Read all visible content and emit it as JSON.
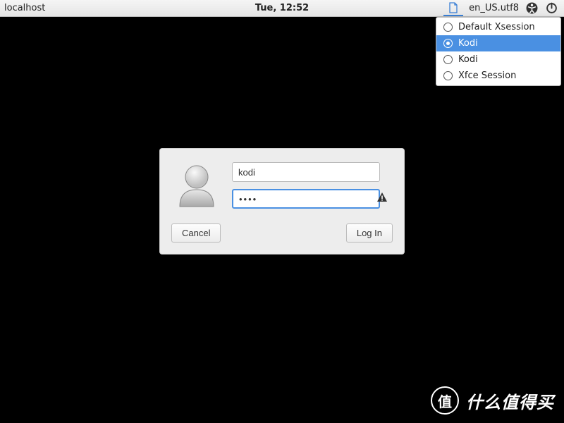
{
  "panel": {
    "hostname": "localhost",
    "clock": "Tue, 12:52",
    "locale": "en_US.utf8"
  },
  "session_menu": {
    "items": [
      {
        "label": "Default Xsession",
        "selected": false
      },
      {
        "label": "Kodi",
        "selected": true
      },
      {
        "label": "Kodi",
        "selected": false
      },
      {
        "label": "Xfce Session",
        "selected": false
      }
    ]
  },
  "login": {
    "username": "kodi",
    "password_mask": "••••",
    "cancel_label": "Cancel",
    "login_label": "Log In"
  },
  "watermark": {
    "badge_char": "值",
    "text": "什么值得买"
  }
}
